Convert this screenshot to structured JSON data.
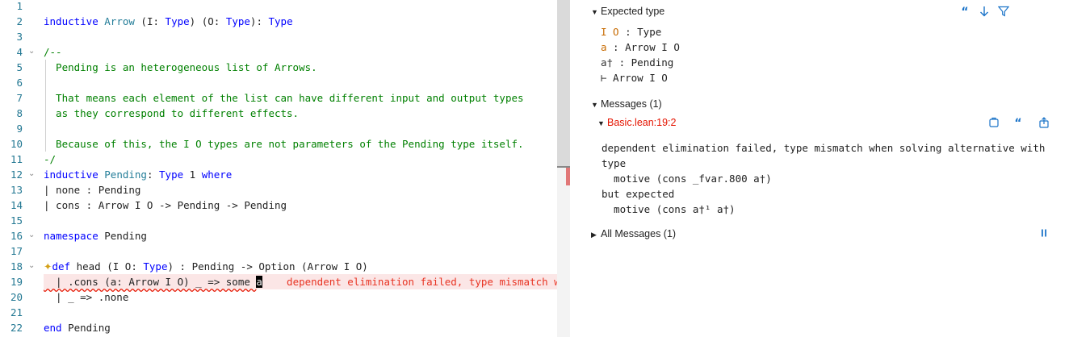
{
  "editor": {
    "lines": [
      {
        "n": "1",
        "segs": []
      },
      {
        "n": "2",
        "segs": [
          {
            "c": "kw",
            "t": "inductive"
          },
          {
            "c": "op",
            "t": " "
          },
          {
            "c": "ty",
            "t": "Arrow"
          },
          {
            "c": "op",
            "t": " (I: "
          },
          {
            "c": "kw",
            "t": "Type"
          },
          {
            "c": "op",
            "t": ") (O: "
          },
          {
            "c": "kw",
            "t": "Type"
          },
          {
            "c": "op",
            "t": "): "
          },
          {
            "c": "kw",
            "t": "Type"
          }
        ]
      },
      {
        "n": "3",
        "segs": []
      },
      {
        "n": "4",
        "fold": true,
        "segs": [
          {
            "c": "cm",
            "t": "/--"
          }
        ]
      },
      {
        "n": "5",
        "guide": true,
        "segs": [
          {
            "c": "cm",
            "t": "  Pending is an heterogeneous list of Arrows."
          }
        ]
      },
      {
        "n": "6",
        "guide": true,
        "segs": []
      },
      {
        "n": "7",
        "guide": true,
        "segs": [
          {
            "c": "cm",
            "t": "  That means each element of the list can have different input and output types"
          }
        ]
      },
      {
        "n": "8",
        "guide": true,
        "segs": [
          {
            "c": "cm",
            "t": "  as they correspond to different effects."
          }
        ]
      },
      {
        "n": "9",
        "guide": true,
        "segs": []
      },
      {
        "n": "10",
        "guide": true,
        "segs": [
          {
            "c": "cm",
            "t": "  Because of this, the I O types are not parameters of the Pending type itself."
          }
        ]
      },
      {
        "n": "11",
        "segs": [
          {
            "c": "cm",
            "t": "-/"
          }
        ]
      },
      {
        "n": "12",
        "fold": true,
        "segs": [
          {
            "c": "kw",
            "t": "inductive"
          },
          {
            "c": "op",
            "t": " "
          },
          {
            "c": "ty",
            "t": "Pending"
          },
          {
            "c": "op",
            "t": ": "
          },
          {
            "c": "kw",
            "t": "Type"
          },
          {
            "c": "op",
            "t": " 1 "
          },
          {
            "c": "kw",
            "t": "where"
          }
        ]
      },
      {
        "n": "13",
        "segs": [
          {
            "c": "op",
            "t": "| none : Pending"
          }
        ]
      },
      {
        "n": "14",
        "segs": [
          {
            "c": "op",
            "t": "| cons : Arrow I O -> Pending -> Pending"
          }
        ]
      },
      {
        "n": "15",
        "segs": []
      },
      {
        "n": "16",
        "fold": true,
        "segs": [
          {
            "c": "kw",
            "t": "namespace"
          },
          {
            "c": "op",
            "t": " Pending"
          }
        ]
      },
      {
        "n": "17",
        "segs": []
      },
      {
        "n": "18",
        "fold": true,
        "sparkle": true,
        "segs": [
          {
            "c": "kw",
            "t": "def"
          },
          {
            "c": "op",
            "t": " head (I O: "
          },
          {
            "c": "kw",
            "t": "Type"
          },
          {
            "c": "op",
            "t": ") : Pending -> Option (Arrow I O)"
          }
        ]
      },
      {
        "n": "19",
        "error": true,
        "segs": [
          {
            "c": "op squiggle",
            "t": "  | .cons (a: Arrow I O) _ => some "
          },
          {
            "c": "cursor-ch",
            "t": "a"
          },
          {
            "c": "op",
            "t": "    "
          },
          {
            "c": "inline-err",
            "t": "dependent elimination failed, type mismatch w"
          }
        ]
      },
      {
        "n": "20",
        "segs": [
          {
            "c": "op",
            "t": "  | _ => .none"
          }
        ]
      },
      {
        "n": "21",
        "segs": []
      },
      {
        "n": "22",
        "segs": [
          {
            "c": "kw",
            "t": "end"
          },
          {
            "c": "op",
            "t": " Pending"
          }
        ]
      }
    ]
  },
  "infoview": {
    "expected_type": {
      "header": "Expected type",
      "hyps": [
        {
          "name": "I O",
          "type": " : Type"
        },
        {
          "name": "a",
          "type": " : Arrow I O"
        },
        {
          "name": "a†",
          "type": " : Pending"
        },
        {
          "name": "⊢",
          "type": " Arrow I O"
        }
      ]
    },
    "messages": {
      "header": "Messages (1)",
      "location": "Basic.lean:19:2",
      "body": [
        "dependent elimination failed, type mismatch when solving alternative with",
        "type",
        "  motive (cons _fvar.800 a†)",
        "but expected",
        "  motive (cons a†¹ a†)"
      ]
    },
    "all_messages": {
      "header": "All Messages (1)"
    },
    "icons": [
      "quote-icon",
      "arrow-down-icon",
      "filter-icon",
      "copy-to-comment-icon",
      "quote-icon",
      "go-to-location-icon",
      "pause-icon"
    ]
  }
}
